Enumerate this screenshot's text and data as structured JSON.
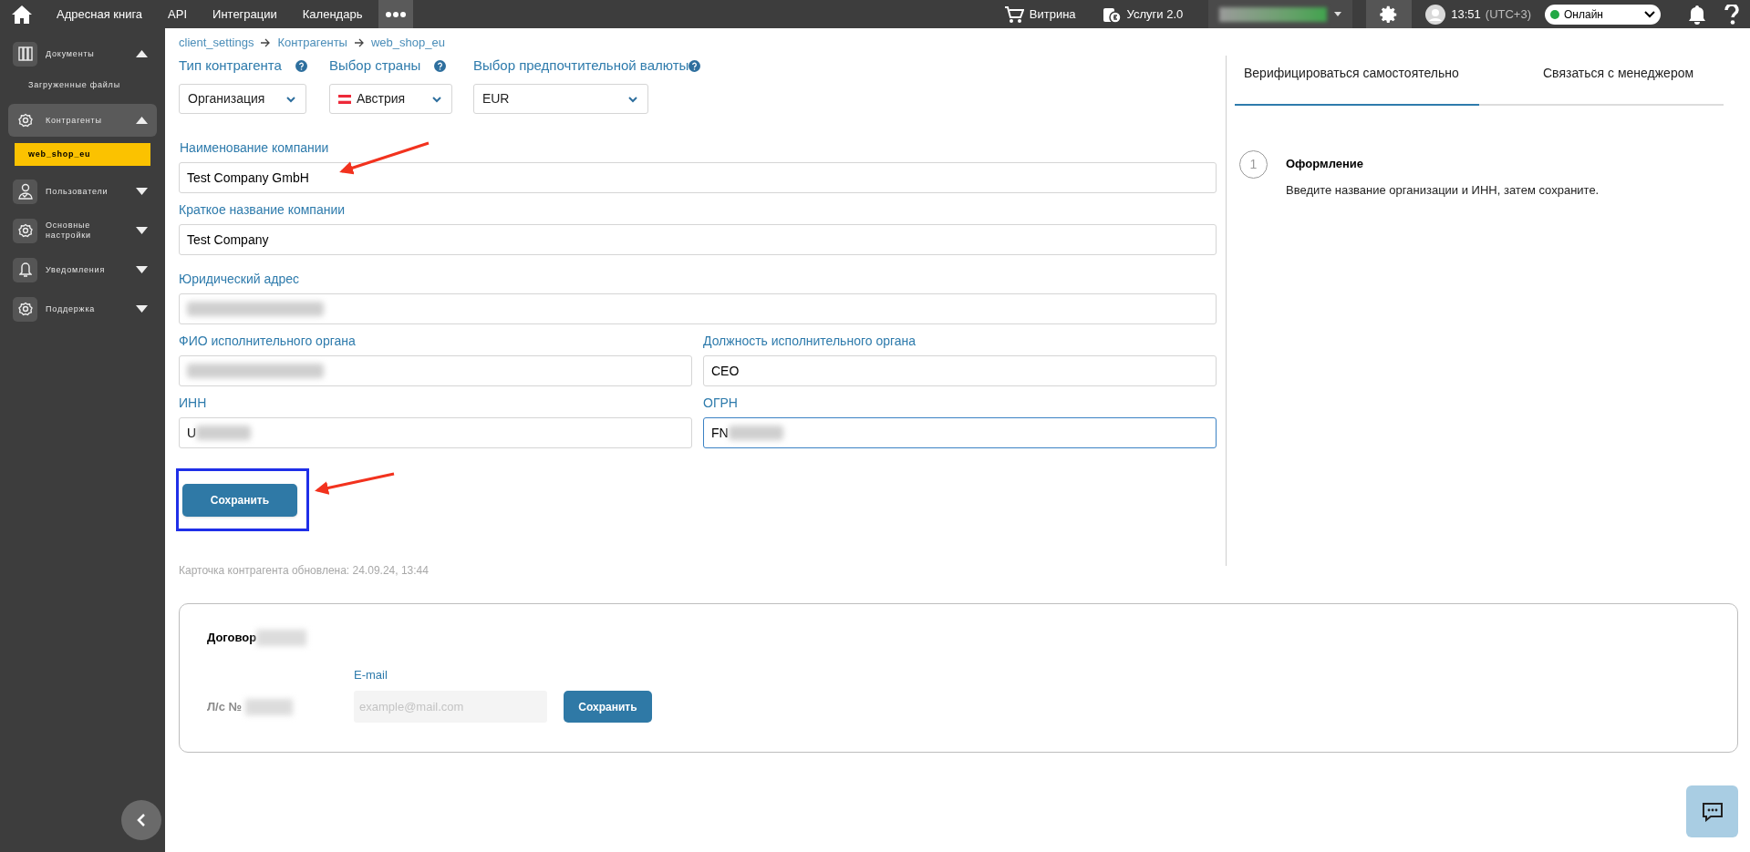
{
  "top_nav": {
    "items": [
      "Адресная книга",
      "API",
      "Интеграции",
      "Календарь"
    ],
    "shop": "Витрина",
    "services": "Услуги 2.0",
    "account": {
      "redacted": true
    },
    "time": "13:51",
    "timezone": "(UTC+3)",
    "status": {
      "label": "Онлайн",
      "color": "#22a845"
    }
  },
  "sidebar": {
    "items": [
      {
        "label": "Документы",
        "expanded": true,
        "selected": false,
        "children": [
          {
            "label": "Загруженные файлы",
            "selected": false
          }
        ]
      },
      {
        "label": "Контрагенты",
        "expanded": true,
        "selected": true,
        "children": [
          {
            "label": "web_shop_eu",
            "selected": true
          }
        ]
      },
      {
        "label": "Пользователи",
        "expanded": false,
        "selected": false
      },
      {
        "label": "Основные настройки",
        "expanded": false,
        "selected": false
      },
      {
        "label": "Уведомления",
        "expanded": false,
        "selected": false
      },
      {
        "label": "Поддержка",
        "expanded": false,
        "selected": false
      }
    ]
  },
  "breadcrumb": [
    "client_settings",
    "Контрагенты",
    "web_shop_eu"
  ],
  "selects": [
    {
      "label": "Тип контрагента",
      "value": "Организация",
      "kind": "plain"
    },
    {
      "label": "Выбор страны",
      "value": "Австрия",
      "kind": "country"
    },
    {
      "label": "Выбор предпочтительной валюты",
      "value": "EUR",
      "kind": "plain"
    }
  ],
  "field_rows": [
    [
      {
        "label": "Наименование компании",
        "value": "Test Company GmbH",
        "redacted": false,
        "focused": false
      }
    ],
    [
      {
        "label": "Краткое название компании",
        "value": "Test Company",
        "redacted": false,
        "focused": false
      }
    ],
    [
      {
        "label": "Юридический адрес",
        "redacted": true,
        "focused": false
      }
    ],
    [
      {
        "label": "ФИО исполнительного органа",
        "redacted": true,
        "focused": false
      },
      {
        "label": "Должность исполнительного органа",
        "value": "CEO",
        "redacted": false,
        "focused": false
      }
    ],
    [
      {
        "label": "ИНН",
        "value": "U",
        "redacted": true,
        "focused": false
      },
      {
        "label": "ОГРН",
        "value": "FN",
        "redacted": true,
        "focused": true
      }
    ]
  ],
  "save_button": "Сохранить",
  "updated_note": "Карточка контрагента обновлена: 24.09.24, 13:44",
  "verification_tabs": [
    {
      "label": "Верифицироваться самостоятельно",
      "selected": true
    },
    {
      "label": "Связаться с менеджером",
      "selected": false
    }
  ],
  "step": {
    "number": "1",
    "title": "Оформление",
    "text": "Введите название организации и ИНН, затем сохраните."
  },
  "contract": {
    "title": "Договор",
    "account_label": "Л/с №",
    "email": {
      "label": "E-mail",
      "placeholder": "example@mail.com"
    },
    "button": "Сохранить"
  }
}
